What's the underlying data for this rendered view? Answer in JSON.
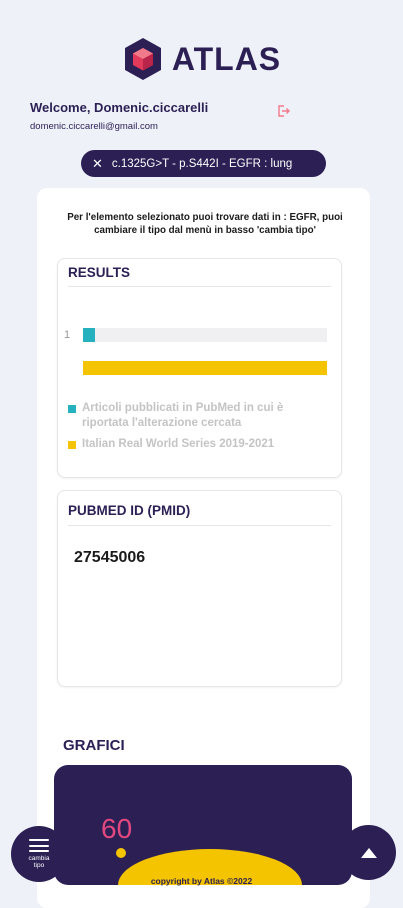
{
  "app": {
    "name": "ATLAS"
  },
  "user": {
    "welcome": "Welcome, Domenic.ciccarelli",
    "email": "domenic.ciccarelli@gmail.com"
  },
  "filter_chip": {
    "label": "c.1325G>T - p.S442I - EGFR : lung"
  },
  "info_text": "Per l'elemento selezionato puoi trovare dati in : EGFR, puoi cambiare il tipo dal menù in basso 'cambia tipo'",
  "results": {
    "title": "RESULTS",
    "bar_label": "1",
    "pubmed_fraction": 0.05,
    "rws_fraction": 1.0,
    "legend": [
      {
        "label": "Articoli pubblicati in PubMed in cui è riportata l'alterazione cercata",
        "color": "#26b1bf"
      },
      {
        "label": "Italian Real World Series 2019-2021",
        "color": "#f5c400"
      }
    ]
  },
  "pubmed": {
    "title": "PUBMED ID (PMID)",
    "ids": [
      "27545006"
    ]
  },
  "charts_section": {
    "title": "GRAFICI",
    "gauge_value": "60"
  },
  "footer": "copyright by Atlas ©2022",
  "fab_menu": {
    "label": "cambia tipo"
  },
  "colors": {
    "primary": "#2b1f54",
    "accent_teal": "#26b1bf",
    "accent_yellow": "#f5c400",
    "gauge_pink": "#e0487f"
  },
  "icons": {
    "logout": "logout-icon",
    "close": "close-icon",
    "menu": "menu-icon",
    "up": "arrow-up-icon",
    "logo": "cube-logo-icon"
  }
}
